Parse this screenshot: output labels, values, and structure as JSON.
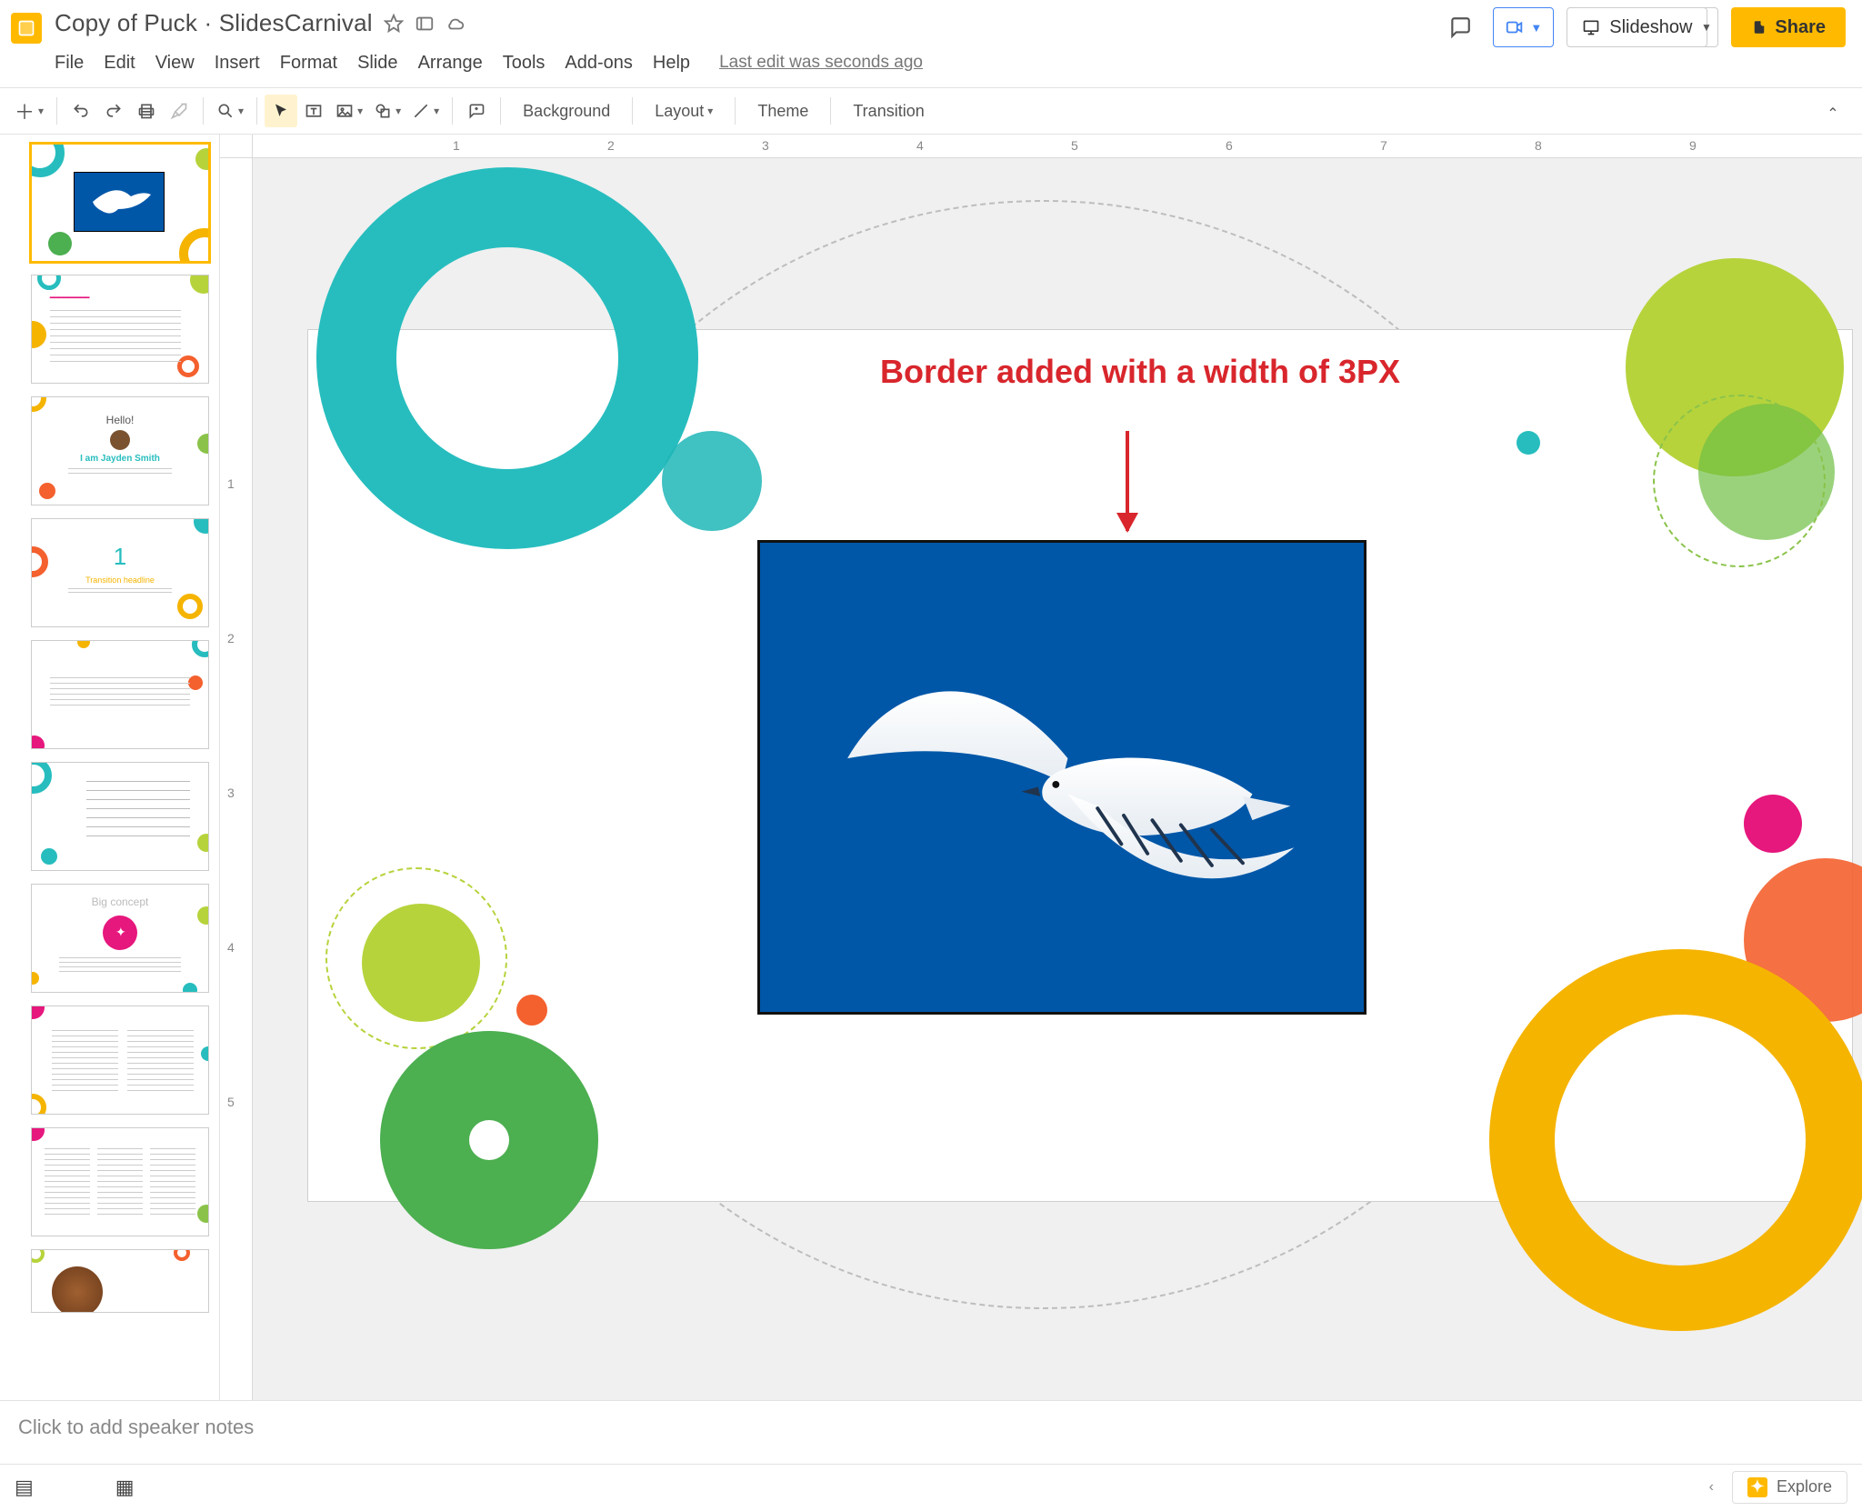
{
  "doc": {
    "title": "Copy of Puck · SlidesCarnival"
  },
  "menu": {
    "file": "File",
    "edit": "Edit",
    "view": "View",
    "insert": "Insert",
    "format": "Format",
    "slide": "Slide",
    "arrange": "Arrange",
    "tools": "Tools",
    "addons": "Add-ons",
    "help": "Help",
    "last_edit": "Last edit was seconds ago"
  },
  "toolbar": {
    "background": "Background",
    "layout": "Layout",
    "theme": "Theme",
    "transition": "Transition"
  },
  "header": {
    "slideshow": "Slideshow",
    "share": "Share"
  },
  "ruler_h": [
    "1",
    "2",
    "3",
    "4",
    "5",
    "6",
    "7",
    "8",
    "9"
  ],
  "ruler_v": [
    "1",
    "2",
    "3",
    "4",
    "5"
  ],
  "annotation": {
    "text": "Border added with a width of 3PX"
  },
  "thumbs": {
    "t3_hello": "Hello!",
    "t3_name": "I am Jayden Smith",
    "t4_num": "1",
    "t4_cap": "Transition headline",
    "t7_title": "Big concept"
  },
  "notes": {
    "placeholder": "Click to add speaker notes"
  },
  "bottom": {
    "explore": "Explore"
  },
  "colors": {
    "teal": "#27bdbe",
    "tealSolid": "#1fb6b7",
    "green": "#8bc34a",
    "lime": "#b6d33c",
    "darkgreen": "#4caf50",
    "orange": "#f4602e",
    "yellow": "#f5b400",
    "pink": "#e6177d",
    "sky": "#0057a8",
    "accent": "#ffba00"
  }
}
